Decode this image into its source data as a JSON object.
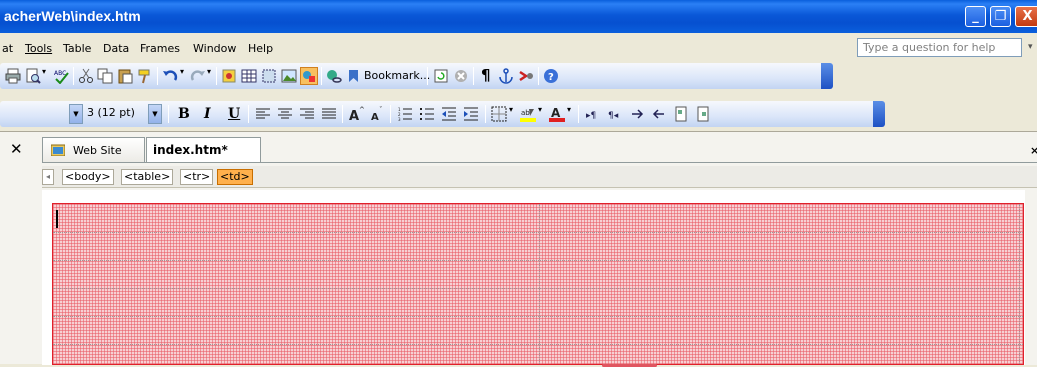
{
  "window": {
    "title": "acherWeb\\index.htm",
    "minimize": "_",
    "restore": "❐",
    "close": "X"
  },
  "menubar": {
    "items": [
      "at",
      "Tools",
      "Table",
      "Data",
      "Frames",
      "Window",
      "Help"
    ],
    "help_placeholder": "Type a question for help"
  },
  "standard_toolbar": {
    "bookmark_label": "Bookmark...",
    "pilcrow": "¶"
  },
  "format_toolbar": {
    "font_size": "3 (12 pt)",
    "bold": "B",
    "italic": "I",
    "underline": "U"
  },
  "tabs": [
    {
      "label": "Web Site",
      "active": false
    },
    {
      "label": "index.htm*",
      "active": true
    }
  ],
  "quick_tags": [
    "<body>",
    "<table>",
    "<tr>",
    "<td>"
  ],
  "selected_tag": "<td>",
  "colors": {
    "title_bar": "#0a58d8",
    "table_border": "#e0202a",
    "selected_tag": "#ffb04c"
  }
}
